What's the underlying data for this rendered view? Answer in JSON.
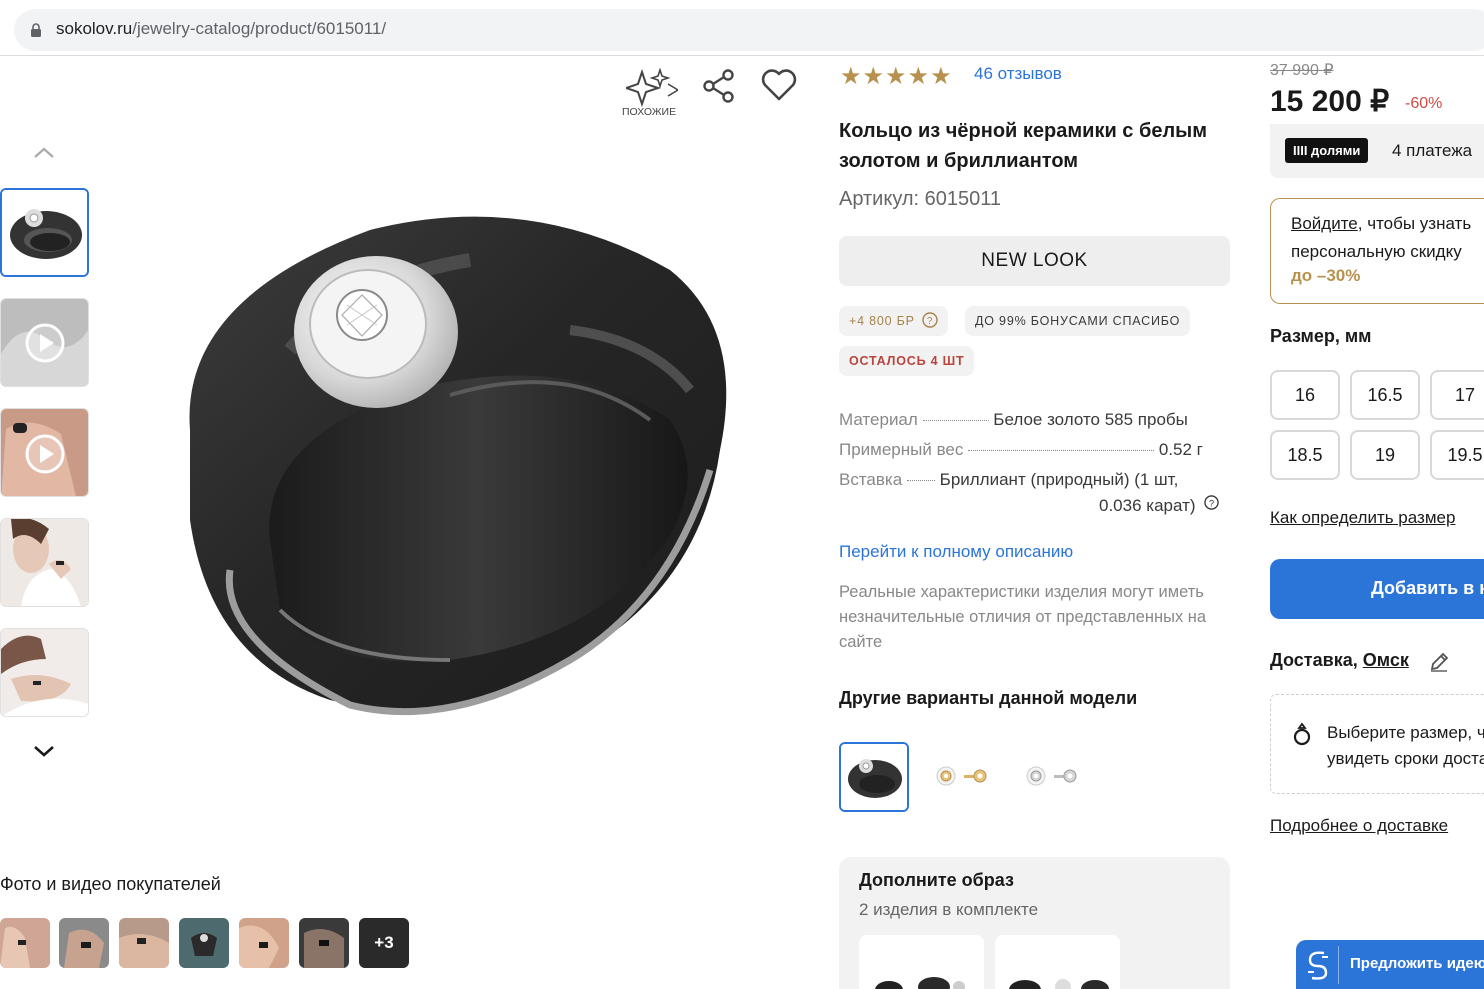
{
  "browser": {
    "url_host": "sokolov.ru",
    "url_path": "/jewelry-catalog/product/6015011/"
  },
  "actions": {
    "similar_label": "ПОХОЖИЕ"
  },
  "product": {
    "rating_stars": "★★★★★",
    "reviews_link": "46 отзывов",
    "title": "Кольцо из чёрной керамики с белым золотом и бриллиантом",
    "article": "Артикул: 6015011",
    "collection_label": "NEW LOOK",
    "bonus_chip": "+4 800 БР",
    "bonus_help_icon": "question-circle-icon",
    "spasibo_chip": "ДО 99% БОНУСАМИ СПАСИБО",
    "stock_chip": "ОСТАЛОСЬ 4 ШТ",
    "specs": {
      "material_key": "Материал",
      "material_value": "Белое золото 585 пробы",
      "weight_key": "Примерный вес",
      "weight_value": "0.52 г",
      "insert_key": "Вставка",
      "insert_value_line1": "Бриллиант (природный) (1 шт,",
      "insert_value_line2": "0.036 карат)"
    },
    "full_description_link": "Перейти к полному описанию",
    "disclaimer": "Реальные характеристики изделия могут иметь незначительные отличия от представленных на сайте",
    "variants_title": "Другие варианты данной модели",
    "complete_title": "Дополните образ",
    "complete_subtitle": "2 изделия в комплекте"
  },
  "pricing": {
    "old_price": "37 990 ₽",
    "price": "15 200 ₽",
    "discount": "-60%",
    "dolyami_badge": "IIII долями",
    "dolyami_text": "4 платежа",
    "login_link": "Войдите",
    "login_text_rest": ", чтобы узнать",
    "login_text_line2": "персональную скидку",
    "login_discount": "до –30%"
  },
  "sizes": {
    "title": "Размер, мм",
    "values": [
      "16",
      "16.5",
      "17",
      "18.5",
      "19",
      "19.5"
    ],
    "how_to_link": "Как определить размер"
  },
  "cart": {
    "add_label": "Добавить в корзину"
  },
  "delivery": {
    "label": "Доставка,",
    "city": "Омск",
    "hint_line1": "Выберите размер, чтобы",
    "hint_line2": "увидеть сроки доставки",
    "more_link": "Подробнее о доставке"
  },
  "customer_photos": {
    "title": "Фото и видео покупателей",
    "more_count": "+3"
  },
  "suggest": {
    "label": "Предложить идею"
  },
  "colors": {
    "accent_blue": "#2b74d8",
    "gold": "#b8914f",
    "sale_red": "#d04a42"
  }
}
